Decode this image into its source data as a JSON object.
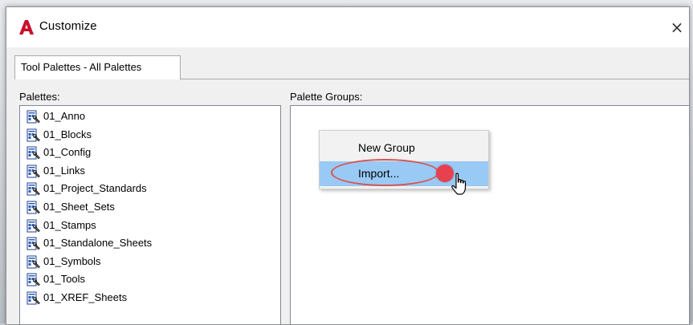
{
  "window": {
    "title": "Customize",
    "close_glyph": "×",
    "logo_icon": "autocad-a-icon",
    "accent_color": "#c8102e"
  },
  "tabs": [
    {
      "label": "Tool Palettes - All Palettes",
      "active": true
    }
  ],
  "palettes": {
    "label": "Palettes:",
    "items": [
      "01_Anno",
      "01_Blocks",
      "01_Config",
      "01_Links",
      "01_Project_Standards",
      "01_Sheet_Sets",
      "01_Stamps",
      "01_Standalone_Sheets",
      "01_Symbols",
      "01_Tools",
      "01_XREF_Sheets"
    ],
    "item_icon": "tool-palette-icon"
  },
  "palette_groups": {
    "label": "Palette Groups:"
  },
  "context_menu": {
    "items": [
      {
        "label": "New Group",
        "highlighted": false
      },
      {
        "label": "Import...",
        "highlighted": true
      }
    ],
    "highlight_color": "#99c9f5"
  },
  "annotation": {
    "highlight_oval_color": "#d9534f",
    "click_marker_color": "#e7414e",
    "cursor_icon": "hand-pointer-icon"
  }
}
